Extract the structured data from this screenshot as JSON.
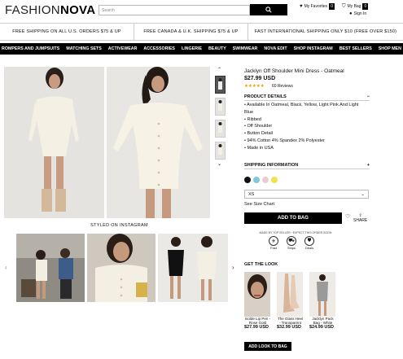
{
  "header": {
    "logo_part1": "FASHION",
    "logo_part2": "NOVA",
    "search_placeholder": "Search",
    "favorites_label": "My Favorites",
    "favorites_count": "0",
    "bag_label": "My Bag",
    "bag_count": "0",
    "signin_label": "Sign In"
  },
  "shipping_bar": [
    "FREE SHIPPING ON ALL U.S. ORDERS $75 & UP",
    "FREE CANADA & U.K. SHIPPING $75 & UP",
    "FAST INTERNATIONAL SHIPPING ONLY $10 (FREE OVER $150)"
  ],
  "nav": [
    "ROMPERS AND JUMPSUITS",
    "MATCHING SETS",
    "ACTIVEWEAR",
    "ACCESSORIES",
    "LINGERIE",
    "BEAUTY",
    "SWIMWEAR",
    "NOVA EDIT",
    "SHOP INSTAGRAM",
    "BEST SELLERS",
    "SHOP MEN"
  ],
  "gallery": {
    "styled_label": "STYLED ON INSTAGRAM"
  },
  "product": {
    "title": "Jacklyn Off Shoulder Mini Dress - Oatmeal",
    "price": "$27.99 USD",
    "stars": "★★★★★",
    "reviews": "60 Reviews",
    "details_header": "PRODUCT DETAILS",
    "details_toggle": "−",
    "details": [
      "Available In Oatmeal, Black, Yellow, Light Pink And Light Blue",
      "Ribbed",
      "Off Shoulder",
      "Button Detail",
      "94% Cotton 4% Spandex 2% Polyester",
      "Made in USA"
    ],
    "shipping_header": "SHIPPING INFORMATION",
    "shipping_toggle": "+",
    "swatches": [
      "#111111",
      "#7ec8d8",
      "#eecbd4",
      "#f2e24a"
    ],
    "size_value": "XS",
    "size_chevron": "⌄",
    "size_chart": "See Size Chart",
    "add_to_bag": "ADD TO BAG",
    "share_label": "SHARE",
    "promo_text": "MADE BY TOP SELLER · EXPECT THIS ORDER SOON",
    "promo_badges": [
      {
        "icon": "plane-icon",
        "glyph": "✈",
        "label": "Fast"
      },
      {
        "icon": "truck-icon",
        "glyph": "⛟",
        "label": "Ships"
      },
      {
        "icon": "tag-icon",
        "glyph": "⛊",
        "label": "Deals"
      }
    ]
  },
  "get_the_look": {
    "header": "GET THE LOOK",
    "items": [
      {
        "name": "Isolde Lip Pen - Rose Gold",
        "price": "$27.99 USD"
      },
      {
        "name": "The Glass Heel - Transparent",
        "price": "$32.99 USD"
      },
      {
        "name": "Jacklyn Pack Bag - White",
        "price": "$24.99 USD"
      }
    ],
    "add_look": "ADD LOOK TO BAG"
  }
}
